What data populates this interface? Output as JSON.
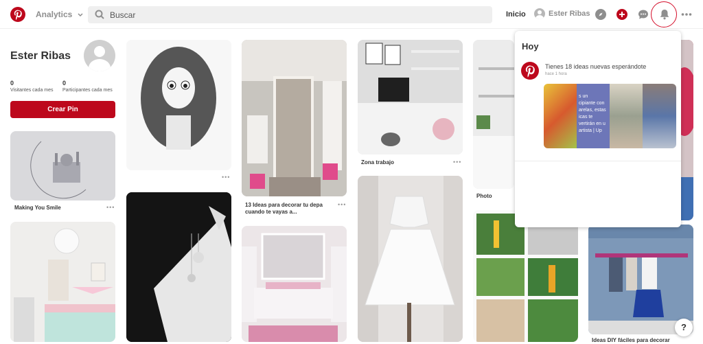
{
  "header": {
    "analytics_label": "Analytics",
    "search_placeholder": "Buscar",
    "home_label": "Inicio",
    "user_label": "Ester Ribas",
    "icons": [
      "pinterest-logo-icon",
      "chevron-down-icon",
      "search-icon",
      "compass-icon",
      "plus-icon",
      "chat-icon",
      "bell-icon",
      "more-icon"
    ],
    "brand_color": "#bd081c"
  },
  "profile": {
    "name": "Ester Ribas",
    "stats": [
      {
        "value": "0",
        "label": "Visitantes cada mes"
      },
      {
        "value": "0",
        "label": "Participantes cada mes"
      }
    ],
    "create_button": "Crear Pin"
  },
  "pins": [
    {
      "caption": "Making You Smile",
      "more": "•••"
    },
    {
      "caption": "",
      "more": "•••"
    },
    {
      "caption": "13 Ideas para decorar tu depa cuando te vayas a...",
      "more": "•••"
    },
    {
      "caption": "Zona trabajo",
      "more": "•••"
    },
    {
      "caption": "Photo",
      "more": "•••"
    },
    {
      "caption": "Ideas DIY fáciles para decorar",
      "more": ""
    }
  ],
  "notifications": {
    "heading": "Hoy",
    "message": "Tienes 18 ideas nuevas esperándote",
    "time": "hace 1 hora",
    "thumb_text": [
      "s un",
      "cipiante con",
      "arelas, estas",
      "icas te",
      "vertirán en u",
      "artista | Up"
    ]
  },
  "help_label": "?"
}
